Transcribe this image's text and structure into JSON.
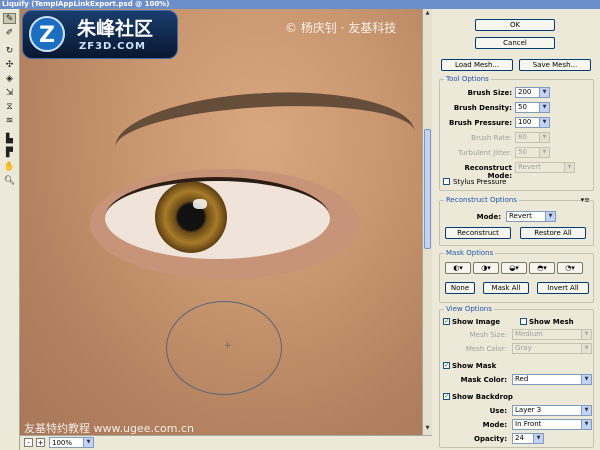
{
  "window": {
    "title": "Liquify (TempIAppLinkExport.psd @ 100%)"
  },
  "watermarks": {
    "logo_cn": "朱峰社区",
    "logo_en": "ZF3D.COM",
    "logo_letter": "Z",
    "top_right": "© 杨庆钊 · 友基科技",
    "bottom_left": "友基特约教程 www.ugee.com.cn"
  },
  "status": {
    "zoom": "100%",
    "zoom_out": "-",
    "zoom_in": "+"
  },
  "buttons": {
    "ok": "OK",
    "cancel": "Cancel",
    "load_mesh": "Load Mesh...",
    "save_mesh": "Save Mesh..."
  },
  "tool_options": {
    "title": "Tool Options",
    "brush_size_label": "Brush Size:",
    "brush_size": "200",
    "brush_density_label": "Brush Density:",
    "brush_density": "50",
    "brush_pressure_label": "Brush Pressure:",
    "brush_pressure": "100",
    "brush_rate_label": "Brush Rate:",
    "brush_rate": "80",
    "turbulent_jitter_label": "Turbulent Jitter:",
    "turbulent_jitter": "50",
    "reconstruct_mode_label": "Reconstruct Mode:",
    "reconstruct_mode": "Revert",
    "stylus_pressure_label": "Stylus Pressure"
  },
  "reconstruct_options": {
    "title": "Reconstruct Options",
    "mode_label": "Mode:",
    "mode": "Revert",
    "reconstruct_label": "Reconstruct",
    "restore_all_label": "Restore All"
  },
  "mask_options": {
    "title": "Mask Options",
    "none_label": "None",
    "mask_all_label": "Mask All",
    "invert_all_label": "Invert All"
  },
  "view_options": {
    "title": "View Options",
    "show_image_label": "Show Image",
    "show_mesh_label": "Show Mesh",
    "mesh_size_label": "Mesh Size:",
    "mesh_size": "Medium",
    "mesh_color_label": "Mesh Color:",
    "mesh_color": "Gray",
    "show_mask_label": "Show Mask",
    "mask_color_label": "Mask Color:",
    "mask_color": "Red",
    "show_backdrop_label": "Show Backdrop",
    "use_label": "Use:",
    "use": "Layer 3",
    "mode_label": "Mode:",
    "mode": "In Front",
    "opacity_label": "Opacity:",
    "opacity": "24"
  },
  "colors": {
    "accent": "#1f56b0",
    "titlebar": "#6c8ec9"
  },
  "icons": [
    "forward-warp-icon",
    "reconstruct-icon",
    "twirl-icon",
    "pucker-icon",
    "bloat-icon",
    "push-left-icon",
    "mirror-icon",
    "turbulence-icon",
    "freeze-mask-icon",
    "thaw-mask-icon",
    "hand-icon",
    "zoom-icon"
  ]
}
